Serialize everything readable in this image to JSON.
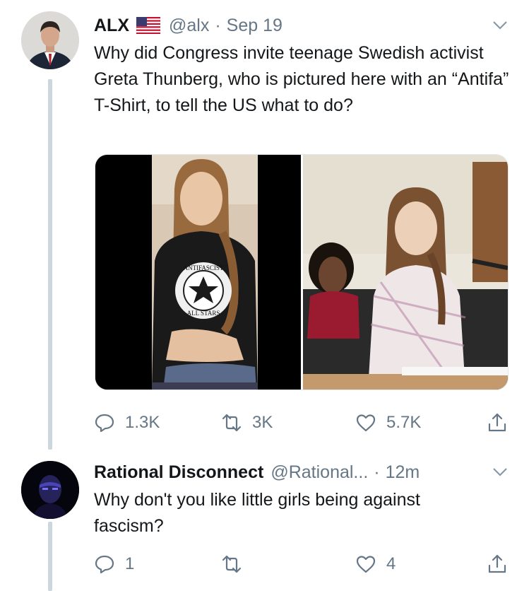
{
  "tweet1": {
    "name": "ALX",
    "handle": "@alx",
    "separator": "·",
    "time": "Sep 19",
    "text": "Why did Congress invite teenage Swedish activist Greta Thunberg, who is pictured here with an “Antifa” T-Shirt, to tell the US what to do?",
    "shirt_text": [
      "ANTIFASCIST",
      "ALL STARS"
    ],
    "reply_count": "1.3K",
    "retweet_count": "3K",
    "like_count": "5.7K"
  },
  "tweet2": {
    "name": "Rational Disconnect",
    "handle": "@Rational...",
    "separator": "·",
    "time": "12m",
    "text": "Why don't you like little girls being against fascism?",
    "reply_count": "1",
    "retweet_count": "",
    "like_count": "4"
  },
  "colors": {
    "text": "#14171a",
    "muted": "#657786",
    "thread_line": "#ccd6dd"
  },
  "icons": [
    "flag-us-icon",
    "chevron-down-icon",
    "reply-icon",
    "retweet-icon",
    "like-icon",
    "share-icon"
  ]
}
